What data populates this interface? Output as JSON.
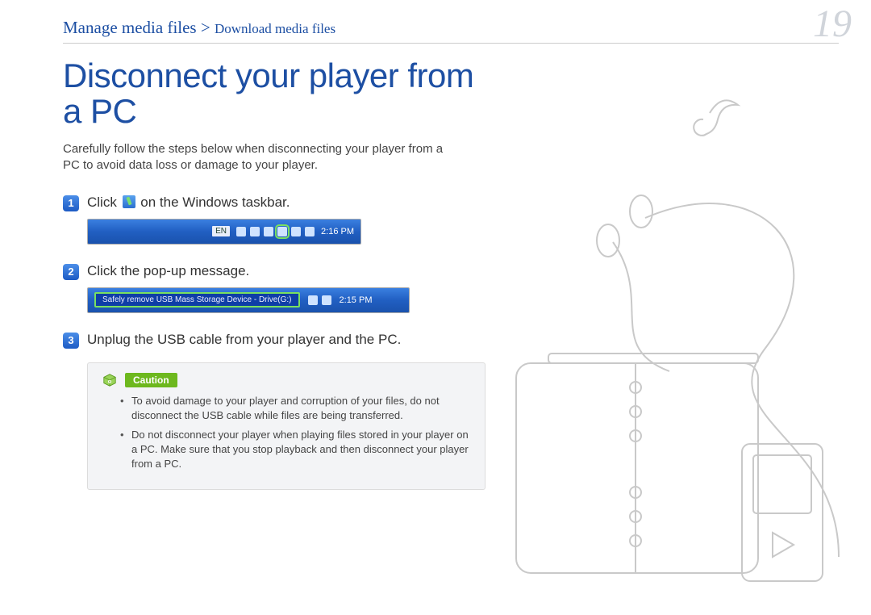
{
  "breadcrumb": {
    "main": "Manage media files",
    "sep": " > ",
    "sub": "Download media files"
  },
  "page_number": "19",
  "title": "Disconnect your player from a PC",
  "intro": "Carefully follow the steps below when disconnecting your player from a PC to avoid data loss or damage to your player.",
  "steps": {
    "s1": {
      "num": "1",
      "pre": "Click ",
      "post": " on the Windows taskbar."
    },
    "s2": {
      "num": "2",
      "text": "Click the pop-up message."
    },
    "s3": {
      "num": "3",
      "text": "Unplug the USB cable from your player and the PC."
    }
  },
  "taskbar": {
    "lang": "EN",
    "clock1": "2:16 PM",
    "popup": "Safely remove USB Mass Storage Device - Drive(G:)",
    "clock2": "2:15 PM"
  },
  "caution": {
    "label": "Caution",
    "items": [
      "To avoid damage to your player and corruption of your files, do not disconnect the USB cable while files are being transferred.",
      "Do not disconnect your player when playing files stored in your player on a PC. Make sure that you stop playback and then disconnect your player from a PC."
    ]
  }
}
